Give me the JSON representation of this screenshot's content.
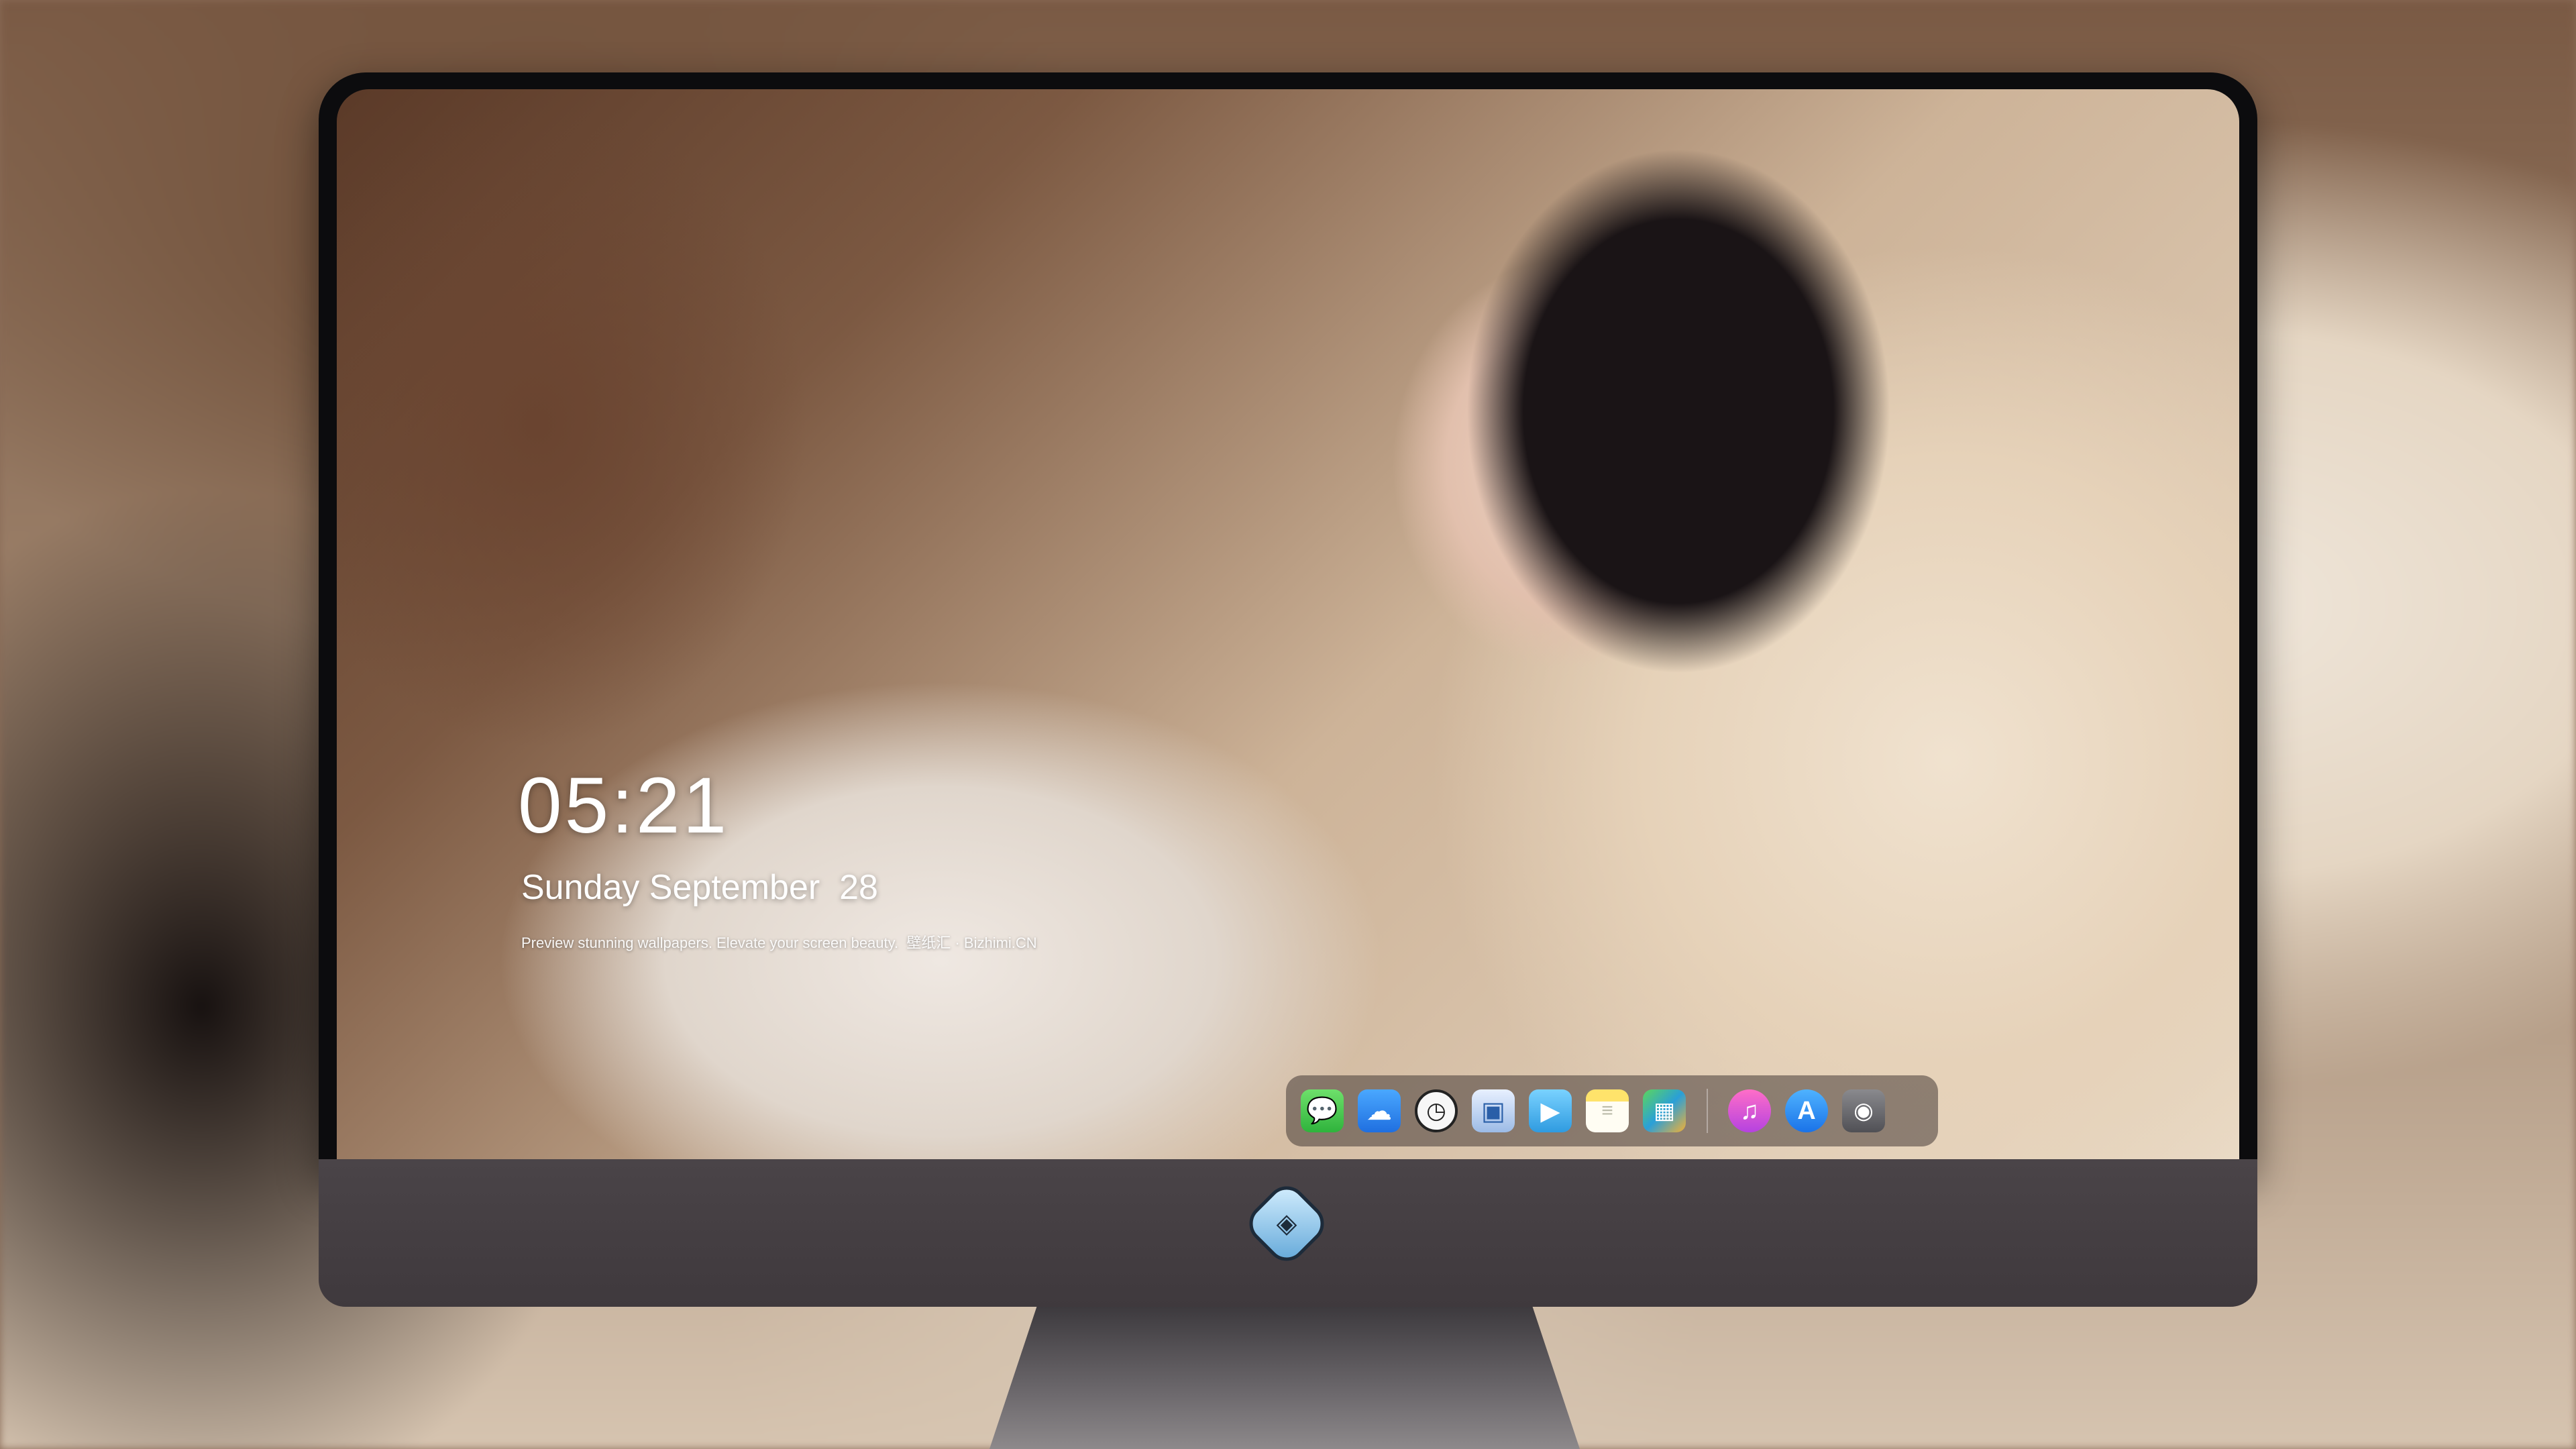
{
  "lockscreen": {
    "time": "05:21",
    "date": "Sunday September  28",
    "tagline": "Preview stunning wallpapers. Elevate your screen beauty.  壁纸汇 · Bizhimi.CN"
  },
  "dock": {
    "apps": [
      {
        "name": "Messages",
        "icon": "messages-icon",
        "glyph": "💬"
      },
      {
        "name": "Weather",
        "icon": "weather-icon",
        "glyph": "☁"
      },
      {
        "name": "Clock",
        "icon": "clock-icon",
        "glyph": "🕘"
      },
      {
        "name": "Preview",
        "icon": "preview-icon",
        "glyph": "🖼"
      },
      {
        "name": "Clips",
        "icon": "clips-icon",
        "glyph": "🎬"
      },
      {
        "name": "Notes",
        "icon": "notes-icon",
        "glyph": "≡"
      },
      {
        "name": "Launchpad",
        "icon": "launchpad-icon",
        "glyph": "▦"
      },
      {
        "name": "Music",
        "icon": "music-icon",
        "glyph": "♫"
      },
      {
        "name": "App Store",
        "icon": "app-store-icon",
        "glyph": "A"
      },
      {
        "name": "Camera",
        "icon": "camera-icon",
        "glyph": "◉"
      }
    ]
  },
  "colors": {
    "bezel": "#0c0c0e",
    "chin": "#4a4448",
    "dock_bg": "rgba(70,58,55,0.55)"
  }
}
